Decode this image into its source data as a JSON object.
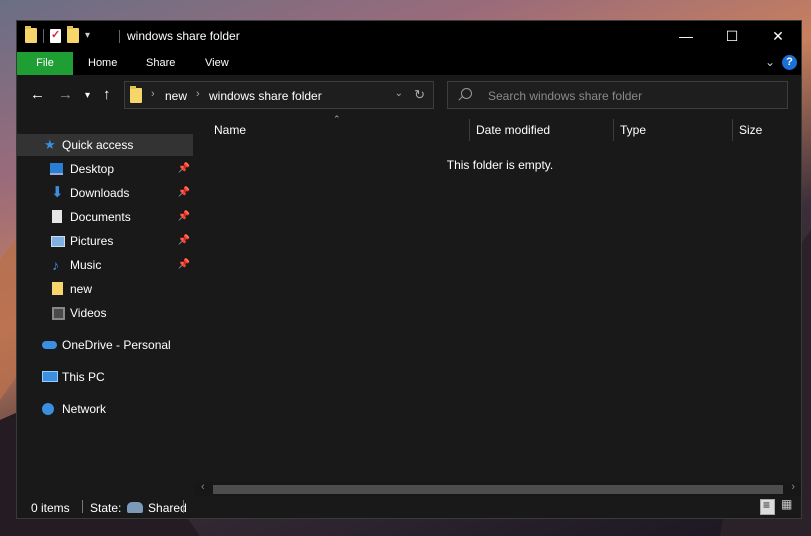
{
  "window": {
    "title": "windows share folder",
    "controls": {
      "minimize": "—",
      "maximize": "☐",
      "close": "✕"
    }
  },
  "ribbon": {
    "tabs": [
      {
        "label": "File"
      },
      {
        "label": "Home"
      },
      {
        "label": "Share"
      },
      {
        "label": "View"
      }
    ],
    "help": "?"
  },
  "nav": {
    "back": "←",
    "forward": "→",
    "recent": "▾",
    "up": "↑"
  },
  "address": {
    "crumbs": [
      "new",
      "windows share folder"
    ],
    "separator": "›",
    "dropdown": "⌄",
    "refresh": "↻"
  },
  "search": {
    "placeholder": "Search windows share folder"
  },
  "sidebar": {
    "quick_access": "Quick access",
    "items": [
      {
        "label": "Desktop",
        "pinned": true,
        "icon": "desktop-icon"
      },
      {
        "label": "Downloads",
        "pinned": true,
        "icon": "download-icon"
      },
      {
        "label": "Documents",
        "pinned": true,
        "icon": "document-icon"
      },
      {
        "label": "Pictures",
        "pinned": true,
        "icon": "pictures-icon"
      },
      {
        "label": "Music",
        "pinned": true,
        "icon": "music-icon"
      },
      {
        "label": "new",
        "pinned": false,
        "icon": "folder-icon"
      },
      {
        "label": "Videos",
        "pinned": false,
        "icon": "videos-icon"
      }
    ],
    "onedrive": "OneDrive - Personal",
    "this_pc": "This PC",
    "network": "Network",
    "pin_glyph": "📌"
  },
  "columns": [
    "Name",
    "Date modified",
    "Type",
    "Size"
  ],
  "content": {
    "empty_message": "This folder is empty."
  },
  "status": {
    "items": "0 items",
    "state_label": "State:",
    "state_value": "Shared"
  },
  "colors": {
    "accent": "#1f9e34",
    "background": "#191919",
    "titlebar": "#000000"
  }
}
